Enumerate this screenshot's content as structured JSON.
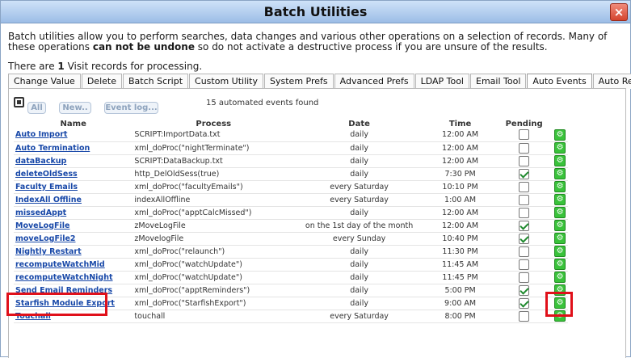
{
  "window": {
    "title": "Batch Utilities",
    "close_icon": "×"
  },
  "intro": {
    "line_before": "Batch utilities allow you to perform searches, data changes and various other operations on a selection of records. Many of these operations ",
    "emphasis": "can not be undone",
    "line_after": " so do not activate a destructive process if you are unsure of the results."
  },
  "record_count": {
    "prefix": "There are ",
    "count": "1",
    "suffix": " Visit records for processing."
  },
  "tabs": [
    {
      "label": "Change Value",
      "active": false
    },
    {
      "label": "Delete",
      "active": false
    },
    {
      "label": "Batch Script",
      "active": false
    },
    {
      "label": "Custom Utility",
      "active": false
    },
    {
      "label": "System Prefs",
      "active": false
    },
    {
      "label": "Advanced Prefs",
      "active": false
    },
    {
      "label": "LDAP Tool",
      "active": false
    },
    {
      "label": "Email Tool",
      "active": false
    },
    {
      "label": "Auto Events",
      "active": true
    },
    {
      "label": "Auto Reports",
      "active": false
    }
  ],
  "toolbar": {
    "all_label": "All",
    "new_label": "New..",
    "event_log_label": "Event log...",
    "found_text": "15 automated events found"
  },
  "columns": {
    "name": "Name",
    "process": "Process",
    "date": "Date",
    "time": "Time",
    "pending": "Pending"
  },
  "events": [
    {
      "name": "Auto Import",
      "process": "SCRIPT:ImportData.txt",
      "date": "daily",
      "time": "12:00 AM",
      "pending": false
    },
    {
      "name": "Auto Termination",
      "process": "xml_doProc(\"nightTerminate\")",
      "date": "daily",
      "time": "12:00 AM",
      "pending": false
    },
    {
      "name": "dataBackup",
      "process": "SCRIPT:DataBackup.txt",
      "date": "daily",
      "time": "12:00 AM",
      "pending": false
    },
    {
      "name": "deleteOldSess",
      "process": "http_DelOldSess(true)",
      "date": "daily",
      "time": "7:30 PM",
      "pending": true
    },
    {
      "name": "Faculty Emails",
      "process": "xml_doProc(\"facultyEmails\")",
      "date": "every Saturday",
      "time": "10:10 PM",
      "pending": false
    },
    {
      "name": "IndexAll Offline",
      "process": "indexAllOffline",
      "date": "every Saturday",
      "time": "1:00 AM",
      "pending": false
    },
    {
      "name": "missedAppt",
      "process": "xml_doProc(\"apptCalcMissed\")",
      "date": "daily",
      "time": "12:00 AM",
      "pending": false
    },
    {
      "name": "MoveLogFile",
      "process": "zMoveLogFile",
      "date": "on the 1st day of the month",
      "time": "12:00 AM",
      "pending": true
    },
    {
      "name": "moveLogFile2",
      "process": "zMovelogFile",
      "date": "every Sunday",
      "time": "10:40 PM",
      "pending": true
    },
    {
      "name": "Nightly Restart",
      "process": "xml_doProc(\"relaunch\")",
      "date": "daily",
      "time": "11:30 PM",
      "pending": false
    },
    {
      "name": "recomputeWatchMid",
      "process": "xml_doProc(\"watchUpdate\")",
      "date": "daily",
      "time": "11:45 AM",
      "pending": false
    },
    {
      "name": "recomputeWatchNight",
      "process": "xml_doProc(\"watchUpdate\")",
      "date": "daily",
      "time": "11:45 PM",
      "pending": false
    },
    {
      "name": "Send Email Reminders",
      "process": "xml_doProc(\"apptReminders\")",
      "date": "daily",
      "time": "5:00 PM",
      "pending": true
    },
    {
      "name": "Starfish Module Export",
      "process": "xml_doProc(\"StarfishExport\")",
      "date": "daily",
      "time": "9:00 AM",
      "pending": true
    },
    {
      "name": "Touchall",
      "process": "touchall",
      "date": "every Saturday",
      "time": "8:00 PM",
      "pending": false
    }
  ],
  "icons": {
    "run_icon": "gear-icon",
    "select_icon": "select-all-icon"
  },
  "colors": {
    "link": "#1848a8",
    "run_button": "#39c23a",
    "highlight": "#e0101a",
    "title_bar": "#b3cdee"
  }
}
